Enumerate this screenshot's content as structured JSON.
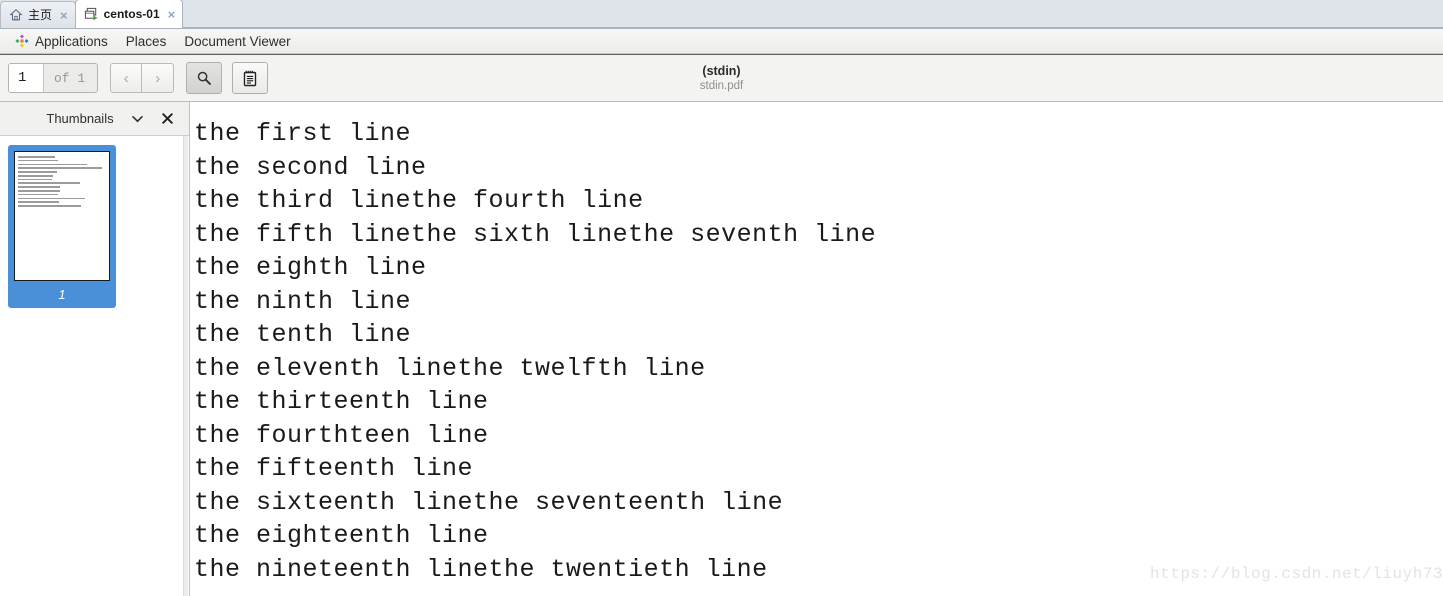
{
  "vm_tabs": {
    "tabs": [
      {
        "label": "主页",
        "icon": "home-icon",
        "active": false,
        "close_label": "×"
      },
      {
        "label": "centos-01",
        "icon": "virtual-machine-icon",
        "active": true,
        "close_label": "×"
      }
    ]
  },
  "desktop_menu": {
    "logo_icon": "centos-logo-icon",
    "items": [
      "Applications",
      "Places",
      "Document Viewer"
    ]
  },
  "toolbar": {
    "page_number_value": "1",
    "page_number_placeholder": "1",
    "page_total_label": "of 1",
    "prev_page_icon": "chevron-left-icon",
    "prev_page_label": "‹",
    "next_page_icon": "chevron-right-icon",
    "next_page_label": "›",
    "search_icon": "search-icon",
    "annotations_icon": "annotations-icon",
    "document_title": "(stdin)",
    "document_filename": "stdin.pdf"
  },
  "sidebar": {
    "title": "Thumbnails",
    "chevron_icon": "chevron-down-icon",
    "chevron_label": "⌄",
    "close_icon": "close-icon",
    "close_label": "✕",
    "thumbnails": [
      {
        "page_label": "1",
        "selected": true
      }
    ]
  },
  "document": {
    "lines": [
      "the first line",
      "the second line",
      "the third linethe fourth line",
      "the fifth linethe sixth linethe seventh line",
      "the eighth line",
      "the ninth line",
      "the tenth line",
      "the eleventh linethe twelfth line",
      "the thirteenth line",
      "the fourthteen line",
      "the fifteenth line",
      "the sixteenth linethe seventeenth line",
      "the eighteenth line",
      "the nineteenth linethe twentieth line"
    ],
    "watermark": "https://blog.csdn.net/liuyh73"
  },
  "colors": {
    "tab_active_bg": "#ffffff",
    "tabbar_bg": "#dfe3ea",
    "toolbar_bg": "#f3f3f1",
    "thumb_selected": "#4a90d9",
    "text": "#1a1a1a",
    "watermark": "#e3e3e3"
  }
}
